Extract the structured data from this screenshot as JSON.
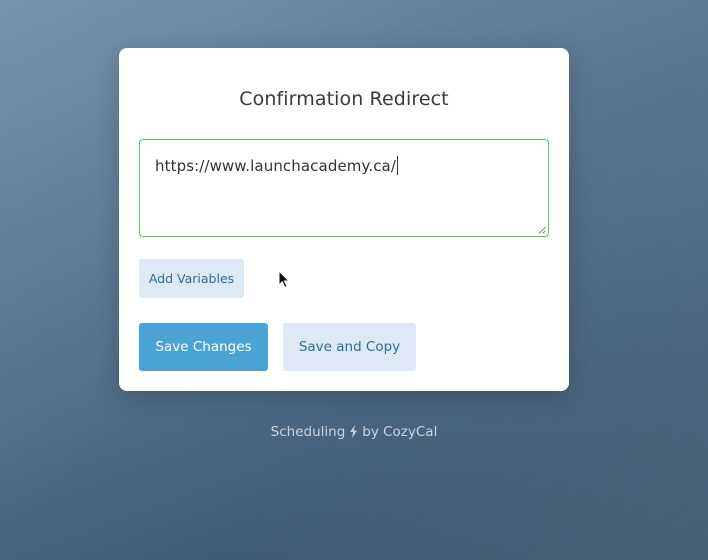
{
  "dialog": {
    "title": "Confirmation Redirect",
    "redirect_url": "https://www.launchacademy.ca/",
    "add_variables_label": "Add Variables",
    "save_changes_label": "Save Changes",
    "save_and_copy_label": "Save and Copy"
  },
  "footer": {
    "prefix": "Scheduling",
    "icon": "lightning-bolt-icon",
    "suffix": "by CozyCal"
  },
  "colors": {
    "accent": "#4aa3d4",
    "secondary_button_bg": "#dde9f4",
    "secondary_button_text": "#2f6e93",
    "input_focus_border": "#5cc45c"
  }
}
